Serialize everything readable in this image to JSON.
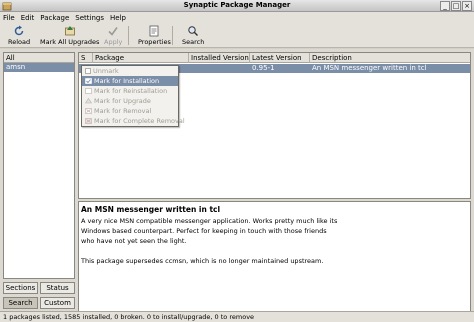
{
  "window": {
    "title": "Synaptic Package Manager"
  },
  "menu": [
    "File",
    "Edit",
    "Package",
    "Settings",
    "Help"
  ],
  "toolbar": {
    "reload": "Reload",
    "mark_all_upgrades": "Mark All Upgrades",
    "apply": "Apply",
    "properties": "Properties",
    "search": "Search"
  },
  "filter_panel": {
    "header": "All",
    "items": [
      "amsn"
    ]
  },
  "left_buttons": {
    "sections": "Sections",
    "status": "Status",
    "search": "Search",
    "custom": "Custom"
  },
  "package_list": {
    "columns": [
      "S",
      "Package",
      "Installed Version",
      "Latest Version",
      "Description"
    ],
    "rows": [
      {
        "s": "",
        "package": "amsn",
        "installed_version": "",
        "latest_version": "0.95-1",
        "description": "An MSN messenger written in tcl"
      }
    ]
  },
  "context_menu": {
    "items": [
      {
        "label": "Unmark",
        "enabled": false
      },
      {
        "label": "Mark for Installation",
        "enabled": true
      },
      {
        "label": "Mark for Reinstallation",
        "enabled": false
      },
      {
        "label": "Mark for Upgrade",
        "enabled": false
      },
      {
        "label": "Mark for Removal",
        "enabled": false
      },
      {
        "label": "Mark for Complete Removal",
        "enabled": false
      }
    ]
  },
  "details": {
    "title": "An MSN messenger written in tcl",
    "lines": [
      "A very nice MSN compatible messenger application. Works pretty much like its",
      "Windows based counterpart. Perfect for keeping in touch with those friends",
      "who have not yet seen the light.",
      "",
      "This package supersedes ccmsn, which is no longer maintained upstream."
    ]
  },
  "status": "1 packages listed, 1585 installed, 0 broken. 0 to install/upgrade, 0 to remove",
  "colors": {
    "selection": "#7b8ea8",
    "background": "#dcd9d2",
    "disabled_text": "#a09c93"
  }
}
